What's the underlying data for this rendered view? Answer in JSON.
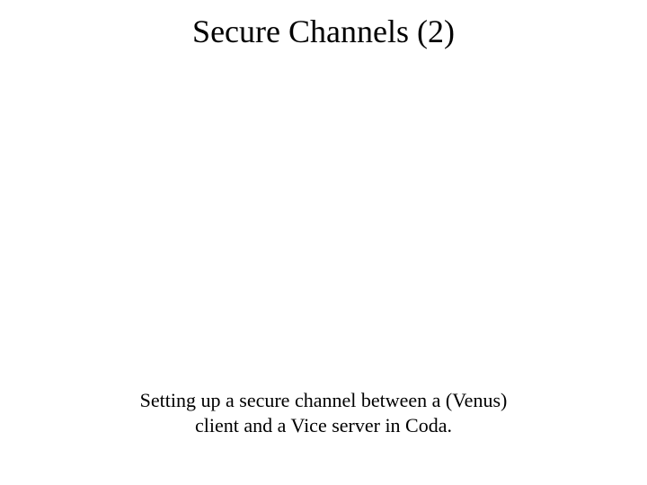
{
  "title": "Secure Channels (2)",
  "caption_line1": "Setting up a secure channel between a (Venus)",
  "caption_line2": "client and a Vice server in Coda."
}
